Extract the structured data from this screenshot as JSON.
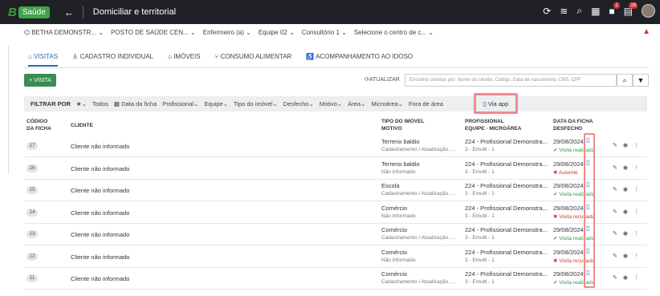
{
  "topbar": {
    "logo_letter": "B",
    "logo_product": "Saúde",
    "back_icon": "arrow-left-icon",
    "title": "Domiciliar e territorial",
    "notif_badge": "2",
    "msg_badge": "16"
  },
  "context": {
    "entity": "BETHA DEMONSTR...",
    "unit": "POSTO DE SAÚDE CEN...",
    "role": "Enfermeiro (a)",
    "team": "Equipe 02",
    "office": "Consultório 1",
    "cost_center": "Selecione o centro de c..."
  },
  "tabs": [
    "VISITAS",
    "CADASTRO INDIVIDUAL",
    "IMÓVEIS",
    "CONSUMO ALIMENTAR",
    "ACOMPANHAMENTO AO IDOSO"
  ],
  "toolbar": {
    "add_label": "+ VISITA",
    "refresh_label": "ATUALIZAR",
    "search_placeholder": "Encontre clientes por: Nome do cliente, Código, Data de nascimento, CNS, CPF"
  },
  "filters": {
    "label": "FILTRAR POR",
    "items": [
      "Todos",
      "Data da ficha",
      "Profissional",
      "Equipe",
      "Tipo do imóvel",
      "Desfecho",
      "Motivo",
      "Área",
      "Microárea",
      "Fora de área"
    ],
    "via_app": "Via app"
  },
  "headers": {
    "code1": "CÓDIGO",
    "code2": "DA FICHA",
    "client": "CLIENTE",
    "type1": "TIPO DO IMÓVEL",
    "type2": "MOTIVO",
    "prof1": "PROFISSIONAL",
    "prof2": "EQUIPE - MICROÁREA",
    "date1": "DATA DA FICHA",
    "date2": "DESFECHO"
  },
  "rows": [
    {
      "code": "17",
      "client": "Cliente não informado",
      "type": "Terreno baldio",
      "reason": "Cadastramento / Atualização, ...",
      "prof": "224 - Profissional Demonstra...",
      "team": "3 - Emulti - 1",
      "date": "29/08/2024",
      "status": "Visita realizada",
      "ok": true
    },
    {
      "code": "16",
      "client": "Cliente não informado",
      "type": "Terreno baldio",
      "reason": "Não informado",
      "prof": "224 - Profissional Demonstra...",
      "team": "3 - Emulti - 1",
      "date": "29/08/2024",
      "status": "Ausente",
      "ok": false
    },
    {
      "code": "15",
      "client": "Cliente não informado",
      "type": "Escola",
      "reason": "Cadastramento / Atualização, ...",
      "prof": "224 - Profissional Demonstra...",
      "team": "3 - Emulti - 1",
      "date": "29/08/2024",
      "status": "Visita realizada",
      "ok": true
    },
    {
      "code": "14",
      "client": "Cliente não informado",
      "type": "Comércio",
      "reason": "Não informado",
      "prof": "224 - Profissional Demonstra...",
      "team": "3 - Emulti - 1",
      "date": "29/08/2024",
      "status": "Visita recusada",
      "ok": false
    },
    {
      "code": "13",
      "client": "Cliente não informado",
      "type": "Comércio",
      "reason": "Cadastramento / Atualização, ...",
      "prof": "224 - Profissional Demonstra...",
      "team": "3 - Emulti - 1",
      "date": "29/08/2024",
      "status": "Visita realizada",
      "ok": true
    },
    {
      "code": "12",
      "client": "Cliente não informado",
      "type": "Comércio",
      "reason": "Não informado",
      "prof": "224 - Profissional Demonstra...",
      "team": "3 - Emulti - 1",
      "date": "29/08/2024",
      "status": "Visita recusada",
      "ok": false
    },
    {
      "code": "11",
      "client": "Cliente não informado",
      "type": "Comércio",
      "reason": "Cadastramento / Atualização, ...",
      "prof": "224 - Profissional Demonstra...",
      "team": "3 - Emulti - 1",
      "date": "29/08/2024",
      "status": "Visita realizada",
      "ok": true
    }
  ],
  "colors": {
    "topbar": "#1f2126",
    "accent": "#2b6ab3",
    "green": "#3a8d52",
    "ok": "#2e9a4a",
    "bad": "#d9342b",
    "highlight": "#f08a8a"
  }
}
